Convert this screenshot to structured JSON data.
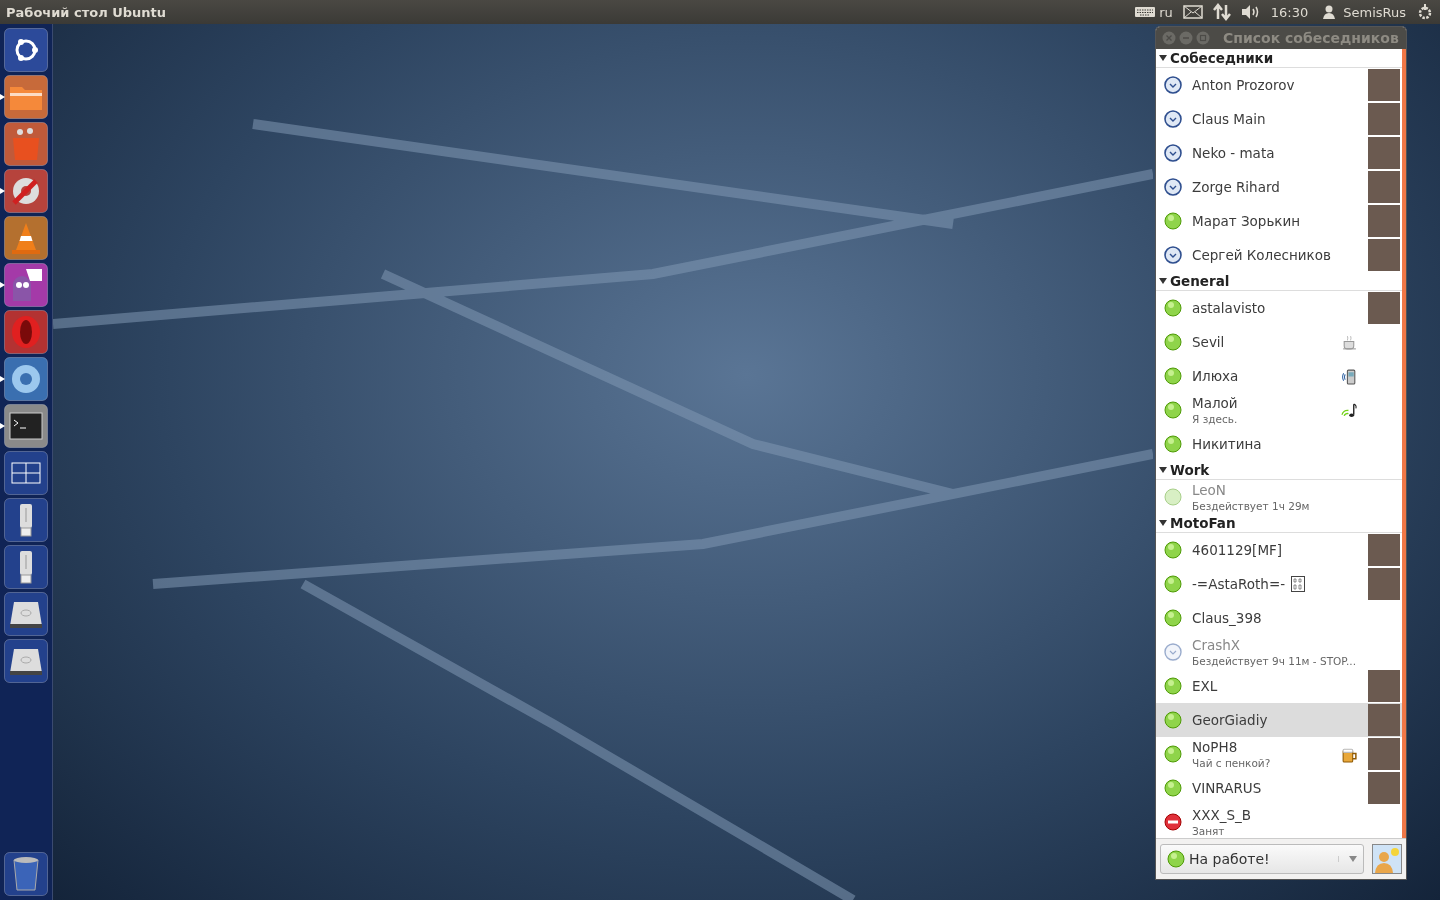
{
  "top_bar": {
    "title": "Рабочий стол Ubuntu",
    "keyboard": "ru",
    "time": "16:30",
    "user": "SemisRus"
  },
  "launcher": [
    {
      "kind": "ubuntu",
      "running": false
    },
    {
      "kind": "folder",
      "running": true
    },
    {
      "kind": "shop",
      "running": false
    },
    {
      "kind": "settings",
      "running": true
    },
    {
      "kind": "cone",
      "running": false
    },
    {
      "kind": "chat",
      "running": true
    },
    {
      "kind": "opera",
      "running": false
    },
    {
      "kind": "browser",
      "running": true
    },
    {
      "kind": "terminal",
      "running": true
    },
    {
      "kind": "workspaces",
      "running": false
    },
    {
      "kind": "usb",
      "running": false
    },
    {
      "kind": "usb",
      "running": false
    },
    {
      "kind": "disk",
      "running": false
    },
    {
      "kind": "disk",
      "running": false
    }
  ],
  "launcher_bottom": [
    {
      "kind": "trash",
      "running": false
    }
  ],
  "window": {
    "title": "Список собеседников",
    "groups": [
      {
        "name": "Собеседники",
        "expanded": true,
        "contacts": [
          {
            "name": "Anton Prozorov",
            "kind": "away",
            "avatar": true,
            "selected": false
          },
          {
            "name": "Claus Main",
            "kind": "away",
            "avatar": true,
            "selected": false
          },
          {
            "name": "Neko - mata",
            "kind": "away",
            "avatar": true,
            "selected": false
          },
          {
            "name": "Zorge Rihard",
            "kind": "away",
            "avatar": true,
            "selected": false
          },
          {
            "name": "Марат Зорькин",
            "kind": "available",
            "avatar": true,
            "selected": false
          },
          {
            "name": "Сергей Колесников",
            "kind": "away",
            "avatar": true,
            "selected": false
          }
        ]
      },
      {
        "name": "General",
        "expanded": true,
        "contacts": [
          {
            "name": "astalavisto",
            "kind": "available",
            "avatar": true,
            "selected": false
          },
          {
            "name": "Sevil",
            "kind": "available",
            "emblem": {
              "kind": "coffee"
            },
            "selected": false
          },
          {
            "name": "Илюха",
            "kind": "available",
            "emblem": {
              "kind": "mobile"
            },
            "selected": false
          },
          {
            "name": "Малой",
            "message": "Я здесь.",
            "kind": "available",
            "emblem": {
              "kind": "music"
            },
            "selected": false
          },
          {
            "name": "Никитина",
            "kind": "available",
            "selected": false
          }
        ]
      },
      {
        "name": "Work",
        "expanded": true,
        "contacts": [
          {
            "name": "LeoN",
            "message": "Бездействует 1ч 29м",
            "kind": "idle",
            "selected": false
          }
        ]
      },
      {
        "name": "MotoFan",
        "expanded": true,
        "contacts": [
          {
            "name": "4601129[MF]",
            "kind": "available",
            "avatar": true,
            "selected": false
          },
          {
            "name": "-=AstaRoth=-",
            "kind": "available",
            "avatar": true,
            "emblem": {
              "kind": "glyph"
            },
            "selected": false
          },
          {
            "name": "Claus_398",
            "kind": "available",
            "selected": false
          },
          {
            "name": "CrashX",
            "message": "Бездействует 9ч 11м - STOP...",
            "kind": "awayidle",
            "selected": false
          },
          {
            "name": "EXL",
            "kind": "available",
            "avatar": true,
            "selected": false
          },
          {
            "name": "GeorGiadiy",
            "kind": "available",
            "avatar": true,
            "selected": true
          },
          {
            "name": "NoPH8",
            "message": "Чай с пенкой?",
            "kind": "available",
            "avatar": true,
            "emblem": {
              "kind": "beer"
            },
            "selected": false
          },
          {
            "name": "VINRARUS",
            "kind": "available",
            "avatar": true,
            "selected": false
          },
          {
            "name": "XXX_S_B",
            "message": "Занят",
            "kind": "busy",
            "selected": false
          }
        ]
      }
    ]
  },
  "status_selector": {
    "value": "На работе!",
    "kind": "available"
  }
}
